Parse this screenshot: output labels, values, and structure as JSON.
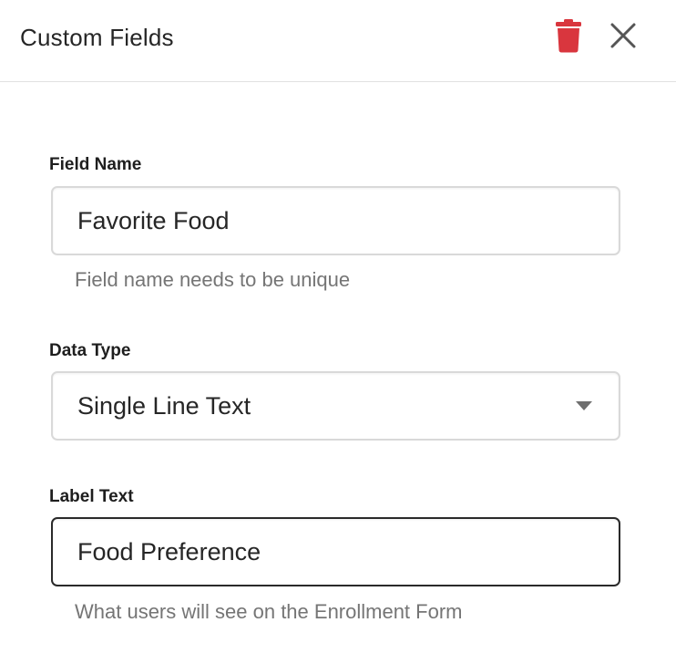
{
  "header": {
    "title": "Custom Fields",
    "delete_icon": "trash-icon",
    "close_icon": "close-icon",
    "delete_color": "#d9363e"
  },
  "form": {
    "field_name": {
      "label": "Field Name",
      "value": "Favorite Food",
      "help": "Field name needs to be unique"
    },
    "data_type": {
      "label": "Data Type",
      "selected": "Single Line Text",
      "icon": "caret-down-icon"
    },
    "label_text": {
      "label": "Label Text",
      "value": "Food Preference",
      "help": "What users will see on the Enrollment Form"
    }
  }
}
